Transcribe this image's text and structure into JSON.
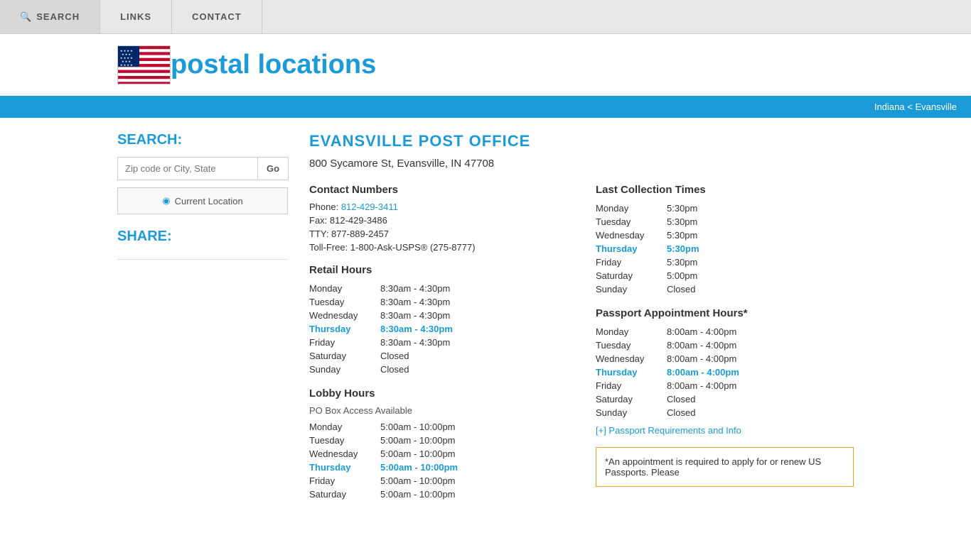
{
  "nav": {
    "search_label": "SEARCH",
    "links_label": "LINKS",
    "contact_label": "CONTACT"
  },
  "header": {
    "logo_text_plain": "postal ",
    "logo_text_accent": "locations"
  },
  "breadcrumb": {
    "state": "Indiana",
    "city": "Evansville",
    "separator": " < "
  },
  "sidebar": {
    "search_title": "SEARCH:",
    "search_placeholder": "Zip code or City, State",
    "search_go": "Go",
    "location_btn": "Current Location",
    "share_title": "SHARE:"
  },
  "post_office": {
    "title": "EVANSVILLE POST OFFICE",
    "address": "800 Sycamore St, Evansville, IN 47708"
  },
  "contact": {
    "heading": "Contact Numbers",
    "phone_label": "Phone: ",
    "phone_number": "812-429-3411",
    "fax": "Fax: 812-429-3486",
    "tty": "TTY: 877-889-2457",
    "tollfree": "Toll-Free: 1-800-Ask-USPS® (275-8777)"
  },
  "retail_hours": {
    "heading": "Retail Hours",
    "rows": [
      {
        "day": "Monday",
        "hours": "8:30am - 4:30pm",
        "today": false
      },
      {
        "day": "Tuesday",
        "hours": "8:30am - 4:30pm",
        "today": false
      },
      {
        "day": "Wednesday",
        "hours": "8:30am - 4:30pm",
        "today": false
      },
      {
        "day": "Thursday",
        "hours": "8:30am - 4:30pm",
        "today": true
      },
      {
        "day": "Friday",
        "hours": "8:30am - 4:30pm",
        "today": false
      },
      {
        "day": "Saturday",
        "hours": "Closed",
        "today": false
      },
      {
        "day": "Sunday",
        "hours": "Closed",
        "today": false
      }
    ]
  },
  "lobby_hours": {
    "heading": "Lobby Hours",
    "subnote": "PO Box Access Available",
    "rows": [
      {
        "day": "Monday",
        "hours": "5:00am - 10:00pm",
        "today": false
      },
      {
        "day": "Tuesday",
        "hours": "5:00am - 10:00pm",
        "today": false
      },
      {
        "day": "Wednesday",
        "hours": "5:00am - 10:00pm",
        "today": false
      },
      {
        "day": "Thursday",
        "hours": "5:00am - 10:00pm",
        "today": true
      },
      {
        "day": "Friday",
        "hours": "5:00am - 10:00pm",
        "today": false
      },
      {
        "day": "Saturday",
        "hours": "5:00am - 10:00pm",
        "today": false
      }
    ]
  },
  "last_collection": {
    "heading": "Last Collection Times",
    "rows": [
      {
        "day": "Monday",
        "hours": "5:30pm",
        "today": false
      },
      {
        "day": "Tuesday",
        "hours": "5:30pm",
        "today": false
      },
      {
        "day": "Wednesday",
        "hours": "5:30pm",
        "today": false
      },
      {
        "day": "Thursday",
        "hours": "5:30pm",
        "today": true
      },
      {
        "day": "Friday",
        "hours": "5:30pm",
        "today": false
      },
      {
        "day": "Saturday",
        "hours": "5:00pm",
        "today": false
      },
      {
        "day": "Sunday",
        "hours": "Closed",
        "today": false
      }
    ]
  },
  "passport_hours": {
    "heading": "Passport Appointment Hours*",
    "rows": [
      {
        "day": "Monday",
        "hours": "8:00am - 4:00pm",
        "today": false
      },
      {
        "day": "Tuesday",
        "hours": "8:00am - 4:00pm",
        "today": false
      },
      {
        "day": "Wednesday",
        "hours": "8:00am - 4:00pm",
        "today": false
      },
      {
        "day": "Thursday",
        "hours": "8:00am - 4:00pm",
        "today": true
      },
      {
        "day": "Friday",
        "hours": "8:00am - 4:00pm",
        "today": false
      },
      {
        "day": "Saturday",
        "hours": "Closed",
        "today": false
      },
      {
        "day": "Sunday",
        "hours": "Closed",
        "today": false
      }
    ]
  },
  "passport_link": "[+] Passport Requirements and Info",
  "passport_note": "*An appointment is required to apply for or renew US Passports. Please"
}
